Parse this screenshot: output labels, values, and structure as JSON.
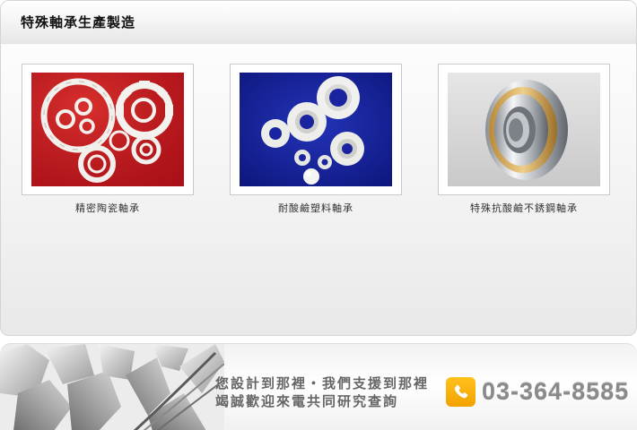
{
  "panel": {
    "title": "特殊軸承生產製造"
  },
  "products": [
    {
      "caption": "精密陶瓷軸承",
      "image_icon": "ceramic-bearing-photo"
    },
    {
      "caption": "耐酸鹼塑料軸承",
      "image_icon": "plastic-bearing-photo"
    },
    {
      "caption": "特殊抗酸鹼不銹鋼軸承",
      "image_icon": "stainless-bearing-photo"
    }
  ],
  "banner": {
    "slogan_line1": "您設計到那裡・我們支援到那裡",
    "slogan_line2": "竭誠歡迎來電共同研究查詢",
    "phone": "03-364-8585",
    "phone_icon": "telephone-icon",
    "accent_color": "#f5a800"
  }
}
